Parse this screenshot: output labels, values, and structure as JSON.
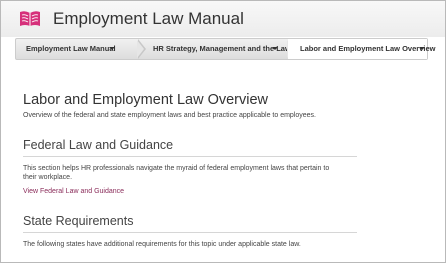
{
  "header": {
    "title": "Employment Law Manual",
    "logo_icon": "open-book-icon",
    "logo_color": "#d6307a"
  },
  "breadcrumb": {
    "items": [
      {
        "label": "Employment Law Manual",
        "active": false
      },
      {
        "label": "HR Strategy, Management and the Law",
        "active": false
      },
      {
        "label": "Labor and Employment Law Overview",
        "active": true
      }
    ]
  },
  "main": {
    "title": "Labor and Employment Law Overview",
    "subtitle": "Overview of the federal and state employment laws and best practice applicable to employees.",
    "sections": [
      {
        "title": "Federal Law and Guidance",
        "text": "This section helps HR professionals navigate the myraid of federal employment laws that pertain to their workplace.",
        "link": "View Federal Law and Guidance"
      },
      {
        "title": "State Requirements",
        "text": "The following states have additional requirements for this topic under applicable state law."
      }
    ]
  },
  "colors": {
    "link": "#8a2c5a",
    "text": "#333333"
  }
}
